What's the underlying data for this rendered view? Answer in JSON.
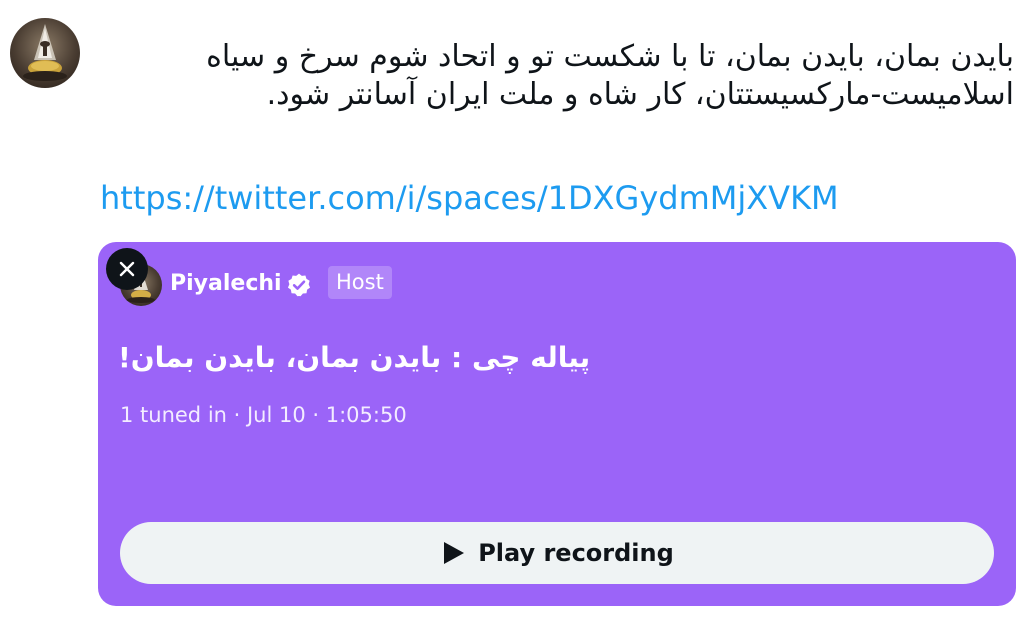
{
  "tweet": {
    "text": "بایدن بمان، بایدن بمان، تا با شکست تو و اتحاد شوم سرخ و سیاه اسلامیست-مارکسیستتان، کار شاه و ملت ایران آسانتر شود.",
    "link": "https://twitter.com/i/spaces/1DXGydmMjXVKM"
  },
  "space_card": {
    "host_name": "Piyalechi",
    "host_badge": "Host",
    "title": "پیاله چی : بایدن بمان، بایدن بمان!",
    "meta": "1 tuned in · Jul 10 · 1:05:50",
    "play_label": "Play recording",
    "background_color": "#9b64f8"
  },
  "icons": {
    "close": "close-icon",
    "verified": "verified-badge-icon",
    "play": "play-icon"
  }
}
